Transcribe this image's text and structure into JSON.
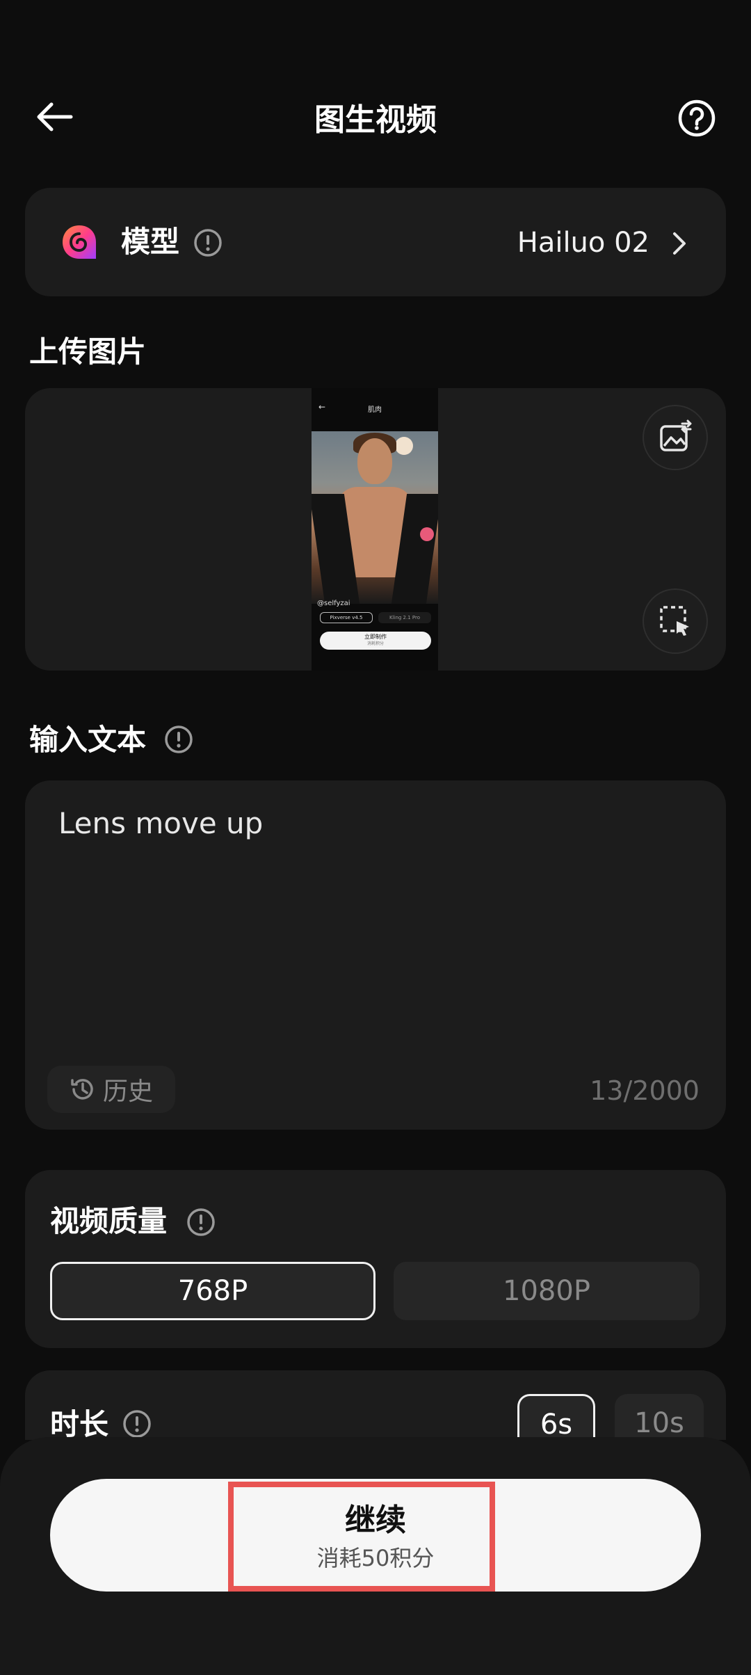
{
  "header": {
    "title": "图生视频",
    "back_icon": "arrow-left-icon",
    "help_icon": "question-circle-icon"
  },
  "model": {
    "label": "模型",
    "value": "Hailuo 02",
    "logo_icon": "hailuo-logo-icon",
    "info_icon": "info-circle-icon",
    "chevron_icon": "chevron-right-icon"
  },
  "upload": {
    "label": "上传图片",
    "replace_icon": "replace-image-icon",
    "select_icon": "select-area-icon",
    "thumbnail": {
      "topbar_title": "肌肉",
      "username": "@selfyzai",
      "chip1": "Pixverse v4.5",
      "chip2": "Kling 2.1 Pro",
      "button": "立即制作",
      "button_sub": "消耗积分"
    }
  },
  "text_input": {
    "label": "输入文本",
    "value": "Lens move up",
    "history_label": "历史",
    "char_count": "13/2000"
  },
  "quality": {
    "label": "视频质量",
    "options": [
      "768P",
      "1080P"
    ],
    "selected": "768P"
  },
  "duration": {
    "label": "时长",
    "options": [
      "6s",
      "10s"
    ],
    "selected": "6s"
  },
  "action": {
    "title": "继续",
    "subtitle": "消耗50积分",
    "highlight_color": "#e85452"
  }
}
